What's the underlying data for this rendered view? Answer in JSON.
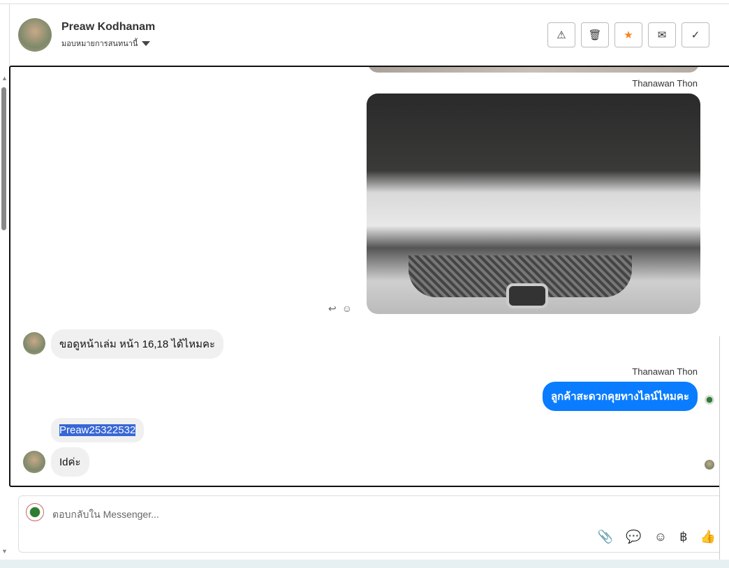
{
  "header": {
    "name": "Preaw Kodhanam",
    "assign_label": "มอบหมายการสนทนานี้"
  },
  "actions": [
    {
      "name": "warning"
    },
    {
      "name": "trash"
    },
    {
      "name": "star"
    },
    {
      "name": "envelope"
    },
    {
      "name": "check"
    }
  ],
  "messages": {
    "sender1": "Thanawan Thon",
    "m1": "ขอดูหน้าเล่ม หน้า 16,18 ได้ไหมคะ",
    "sender2": "Thanawan Thon",
    "m2": "ลูกค้าสะดวกคุยทางไลน์ไหมคะ",
    "m3": "Preaw25322532",
    "m4": "Idค่ะ"
  },
  "composer": {
    "placeholder": "ตอบกลับใน Messenger..."
  },
  "colors": {
    "accent": "#0a7cff",
    "star": "#f5831f"
  }
}
